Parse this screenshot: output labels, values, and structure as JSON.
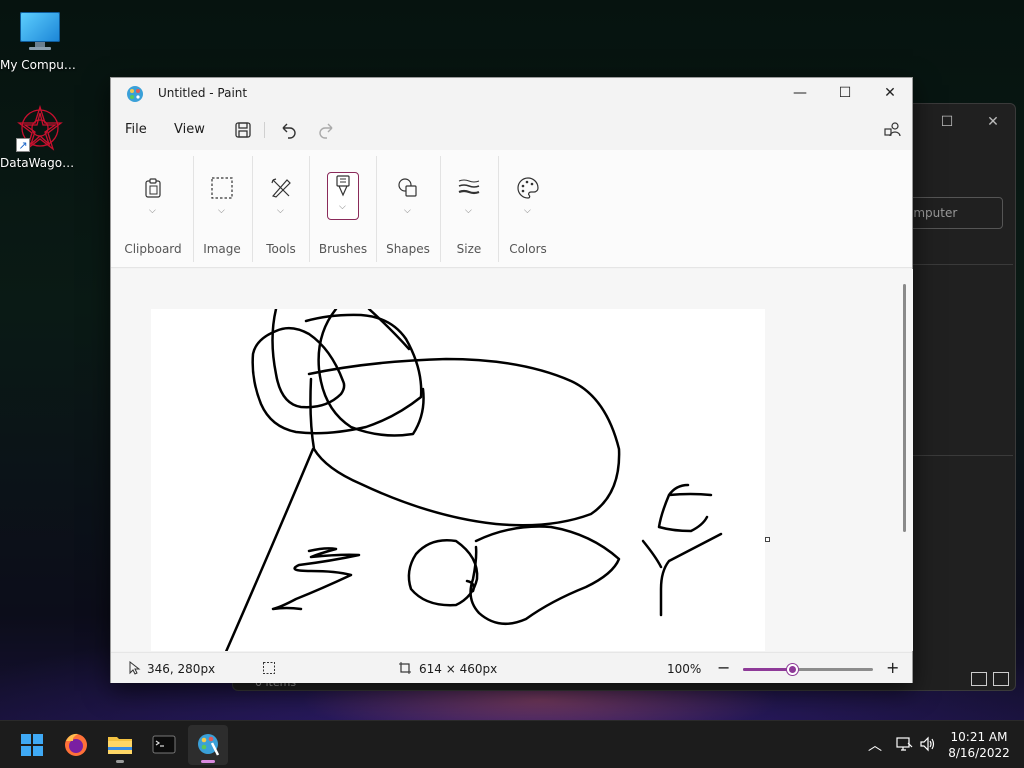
{
  "desktop": {
    "icons": [
      {
        "label": "My Computer"
      },
      {
        "label": "DataWagon..."
      }
    ]
  },
  "background_window": {
    "field_text": "omputer",
    "status_text": "0 items"
  },
  "paint": {
    "title": "Untitled - Paint",
    "menu": {
      "file": "File",
      "view": "View"
    },
    "ribbon": {
      "groups": [
        {
          "label": "Clipboard",
          "icon": "clipboard-icon"
        },
        {
          "label": "Image",
          "icon": "selection-icon"
        },
        {
          "label": "Tools",
          "icon": "tools-icon"
        },
        {
          "label": "Brushes",
          "icon": "brush-icon"
        },
        {
          "label": "Shapes",
          "icon": "shapes-icon"
        },
        {
          "label": "Size",
          "icon": "size-icon"
        },
        {
          "label": "Colors",
          "icon": "palette-icon"
        }
      ]
    },
    "status": {
      "cursor_pos": "346, 280px",
      "canvas_size": "614 × 460px",
      "zoom": "100%",
      "zoom_fraction": 0.38
    }
  },
  "taskbar": {
    "time": "10:21 AM",
    "date": "8/16/2022"
  },
  "colors": {
    "accent": "#8e3a98"
  }
}
